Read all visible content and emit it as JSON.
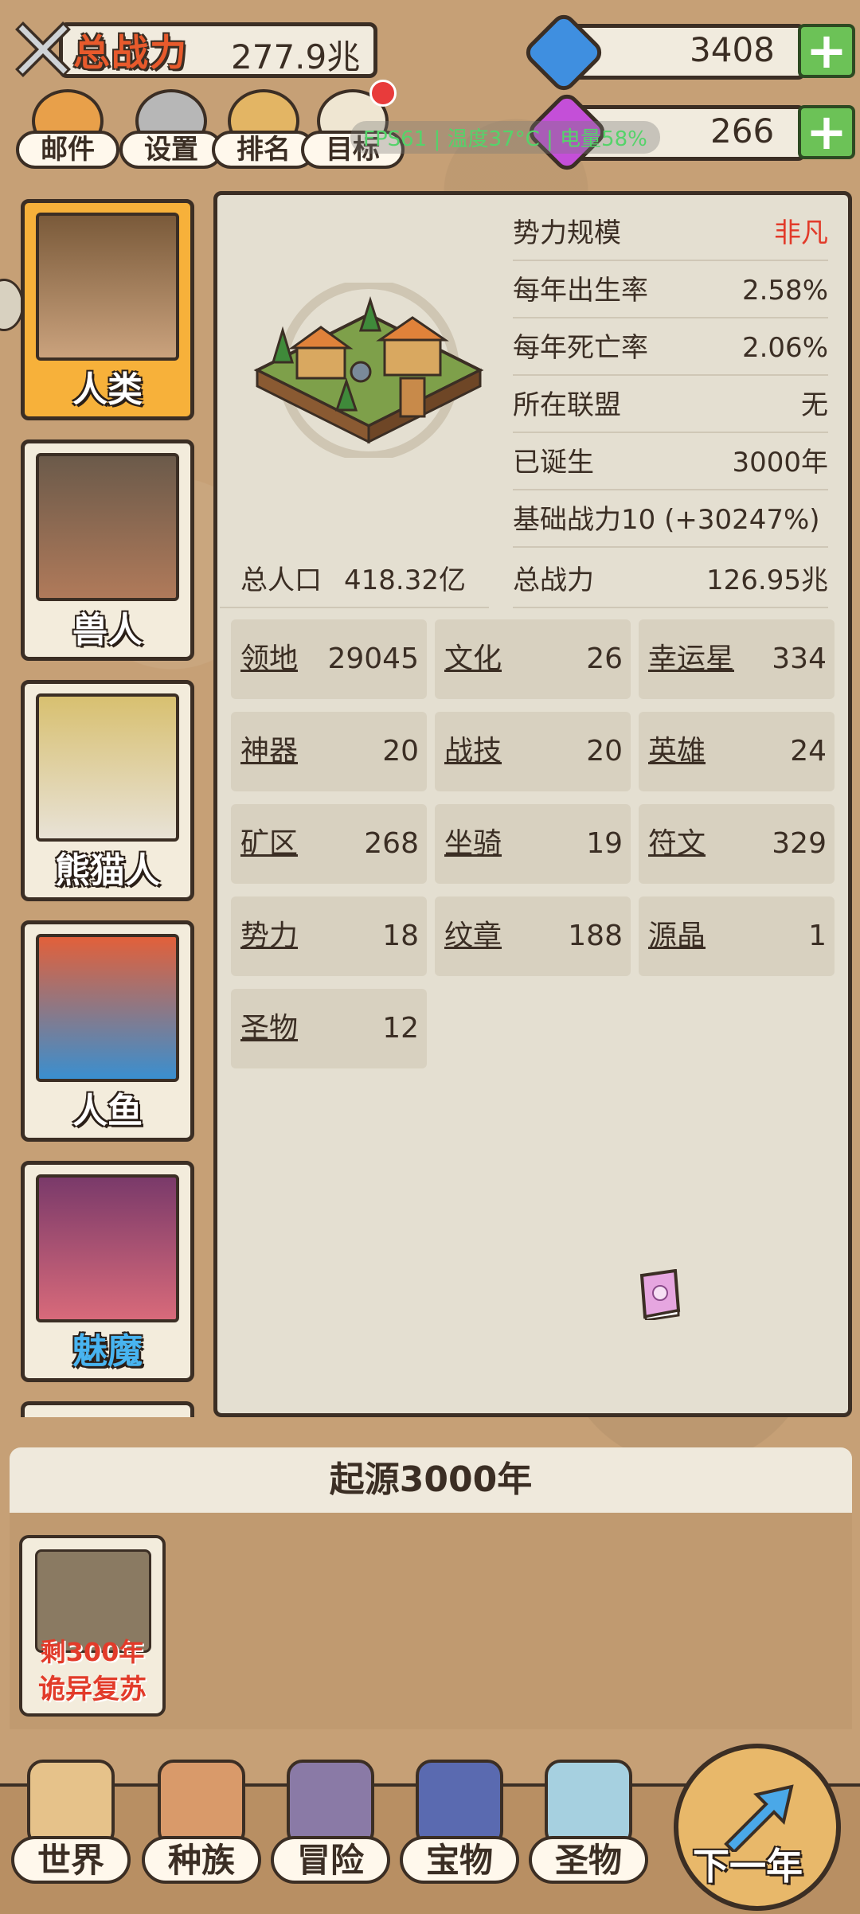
{
  "header": {
    "power_label": "总战力",
    "power_value": "277.9兆",
    "currency1_value": "3408",
    "currency2_value": "266",
    "overlay_text": "FPS61 | 温度37°C | 电量58%"
  },
  "top_buttons": [
    {
      "label": "邮件",
      "icon": "mail-icon"
    },
    {
      "label": "设置",
      "icon": "gear-icon"
    },
    {
      "label": "排名",
      "icon": "ranking-icon"
    },
    {
      "label": "目标",
      "icon": "goal-icon"
    }
  ],
  "races": [
    {
      "name": "人类",
      "active": true
    },
    {
      "name": "兽人",
      "active": false
    },
    {
      "name": "熊猫人",
      "active": false
    },
    {
      "name": "人鱼",
      "active": false
    },
    {
      "name": "魅魔",
      "active": false
    }
  ],
  "info": {
    "rows": [
      {
        "key": "势力规模",
        "value": "非凡"
      },
      {
        "key": "每年出生率",
        "value": "2.58%"
      },
      {
        "key": "每年死亡率",
        "value": "2.06%"
      },
      {
        "key": "所在联盟",
        "value": "无"
      },
      {
        "key": "已诞生",
        "value": "3000年"
      },
      {
        "key": "基础战力10 (+30247%)",
        "value": ""
      },
      {
        "key": "总战力",
        "value": "126.95兆"
      }
    ],
    "population_label": "总人口",
    "population_value": "418.32亿"
  },
  "stats": [
    {
      "key": "领地",
      "value": "29045"
    },
    {
      "key": "文化",
      "value": "26"
    },
    {
      "key": "幸运星",
      "value": "334"
    },
    {
      "key": "神器",
      "value": "20"
    },
    {
      "key": "战技",
      "value": "20"
    },
    {
      "key": "英雄",
      "value": "24"
    },
    {
      "key": "矿区",
      "value": "268"
    },
    {
      "key": "坐骑",
      "value": "19"
    },
    {
      "key": "符文",
      "value": "329"
    },
    {
      "key": "势力",
      "value": "18"
    },
    {
      "key": "纹章",
      "value": "188"
    },
    {
      "key": "源晶",
      "value": "1"
    },
    {
      "key": "圣物",
      "value": "12"
    }
  ],
  "era": {
    "title": "起源3000年"
  },
  "event": {
    "line1": "剩300年",
    "line2": "诡异复苏"
  },
  "nav": [
    {
      "label": "世界"
    },
    {
      "label": "种族"
    },
    {
      "label": "冒险"
    },
    {
      "label": "宝物"
    },
    {
      "label": "圣物"
    }
  ],
  "next_label": "下一年",
  "colors": {
    "accent_orange": "#f7b13a",
    "value_red": "#e23b2a",
    "plus_green": "#6cc257",
    "blue_name": "#48b4f0"
  }
}
